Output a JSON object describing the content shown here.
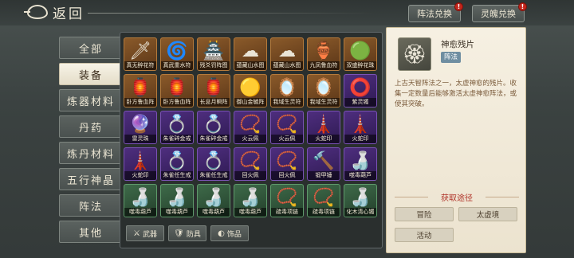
{
  "header": {
    "back_label": "返回",
    "buttons": [
      {
        "label": "阵法兑换",
        "badge": "!"
      },
      {
        "label": "灵魄兑换",
        "badge": "!"
      }
    ]
  },
  "categories": [
    {
      "label": "全部",
      "active": false
    },
    {
      "label": "装备",
      "active": true
    },
    {
      "label": "炼器材料",
      "active": false
    },
    {
      "label": "丹药",
      "active": false
    },
    {
      "label": "炼丹材料",
      "active": false
    },
    {
      "label": "五行神晶",
      "active": false
    },
    {
      "label": "阵法",
      "active": false
    },
    {
      "label": "其他",
      "active": false
    }
  ],
  "items": [
    {
      "name": "真无醉花符",
      "quality": "orange",
      "icon": "🗡"
    },
    {
      "name": "真武重水符",
      "quality": "orange",
      "icon": "🌀"
    },
    {
      "name": "残爻罚阵图",
      "quality": "orange",
      "icon": "🏯"
    },
    {
      "name": "蕴藏山水图",
      "quality": "orange",
      "icon": "☁"
    },
    {
      "name": "蕴藏山水图",
      "quality": "orange",
      "icon": "☁"
    },
    {
      "name": "九凤鲁血符",
      "quality": "orange",
      "icon": "🏺"
    },
    {
      "name": "双盛醉花珠",
      "quality": "orange",
      "icon": "🟢"
    },
    {
      "name": "卧方鲁血阵",
      "quality": "orange",
      "icon": "🏮"
    },
    {
      "name": "卧方鲁血阵",
      "quality": "orange",
      "icon": "🏮"
    },
    {
      "name": "长息月瞬阵",
      "quality": "orange",
      "icon": "🏮"
    },
    {
      "name": "御山金毓阵",
      "quality": "orange",
      "icon": "🟡"
    },
    {
      "name": "我域生灵符",
      "quality": "orange",
      "icon": "🪞"
    },
    {
      "name": "我域生灵符",
      "quality": "orange",
      "icon": "🪞"
    },
    {
      "name": "紫灵镯",
      "quality": "purple",
      "icon": "⭕"
    },
    {
      "name": "雷灵珠",
      "quality": "purple",
      "icon": "🔮"
    },
    {
      "name": "朱雀碎金戒",
      "quality": "purple",
      "icon": "💍"
    },
    {
      "name": "朱雀碎金戒",
      "quality": "purple",
      "icon": "💍"
    },
    {
      "name": "火云佩",
      "quality": "purple",
      "icon": "📿"
    },
    {
      "name": "火云佩",
      "quality": "purple",
      "icon": "📿"
    },
    {
      "name": "火蛇印",
      "quality": "purple",
      "icon": "🗼"
    },
    {
      "name": "火蛇印",
      "quality": "purple",
      "icon": "🗼"
    },
    {
      "name": "火蛇印",
      "quality": "purple",
      "icon": "🗼"
    },
    {
      "name": "朱雀任生戒",
      "quality": "purple",
      "icon": "💍"
    },
    {
      "name": "朱雀任生戒",
      "quality": "purple",
      "icon": "💍"
    },
    {
      "name": "回火佩",
      "quality": "purple",
      "icon": "📿"
    },
    {
      "name": "回火佩",
      "quality": "purple",
      "icon": "📿"
    },
    {
      "name": "锻甲锤",
      "quality": "purple",
      "icon": "🔨"
    },
    {
      "name": "噬毒葫芦",
      "quality": "purple",
      "icon": "🍶"
    },
    {
      "name": "噬毒葫芦",
      "quality": "green",
      "icon": "🍶"
    },
    {
      "name": "噬毒葫芦",
      "quality": "green",
      "icon": "🍶"
    },
    {
      "name": "噬毒葫芦",
      "quality": "green",
      "icon": "🍶"
    },
    {
      "name": "噬毒葫芦",
      "quality": "green",
      "icon": "🍶"
    },
    {
      "name": "疏毒项链",
      "quality": "green",
      "icon": "📿"
    },
    {
      "name": "疏毒项链",
      "quality": "green",
      "icon": "📿"
    },
    {
      "name": "化木清心镯",
      "quality": "green",
      "icon": "🍶"
    }
  ],
  "filters": [
    {
      "label": "武器",
      "icon": "sword-icon",
      "glyph": "⚔"
    },
    {
      "label": "防具",
      "icon": "armor-icon",
      "glyph": "🛡"
    },
    {
      "label": "饰品",
      "icon": "ring-icon",
      "glyph": "◐"
    }
  ],
  "detail": {
    "name": "神愈残片",
    "tag": "阵法",
    "icon": "🏵",
    "description": "上古天智阵法之一，太虚神愈的残片。收集一定数量后能够激活太虚神愈阵法，或使其突破。",
    "acquire_title": "获取途径",
    "acquire_buttons": [
      "冒险",
      "太虚境",
      "活动"
    ]
  }
}
